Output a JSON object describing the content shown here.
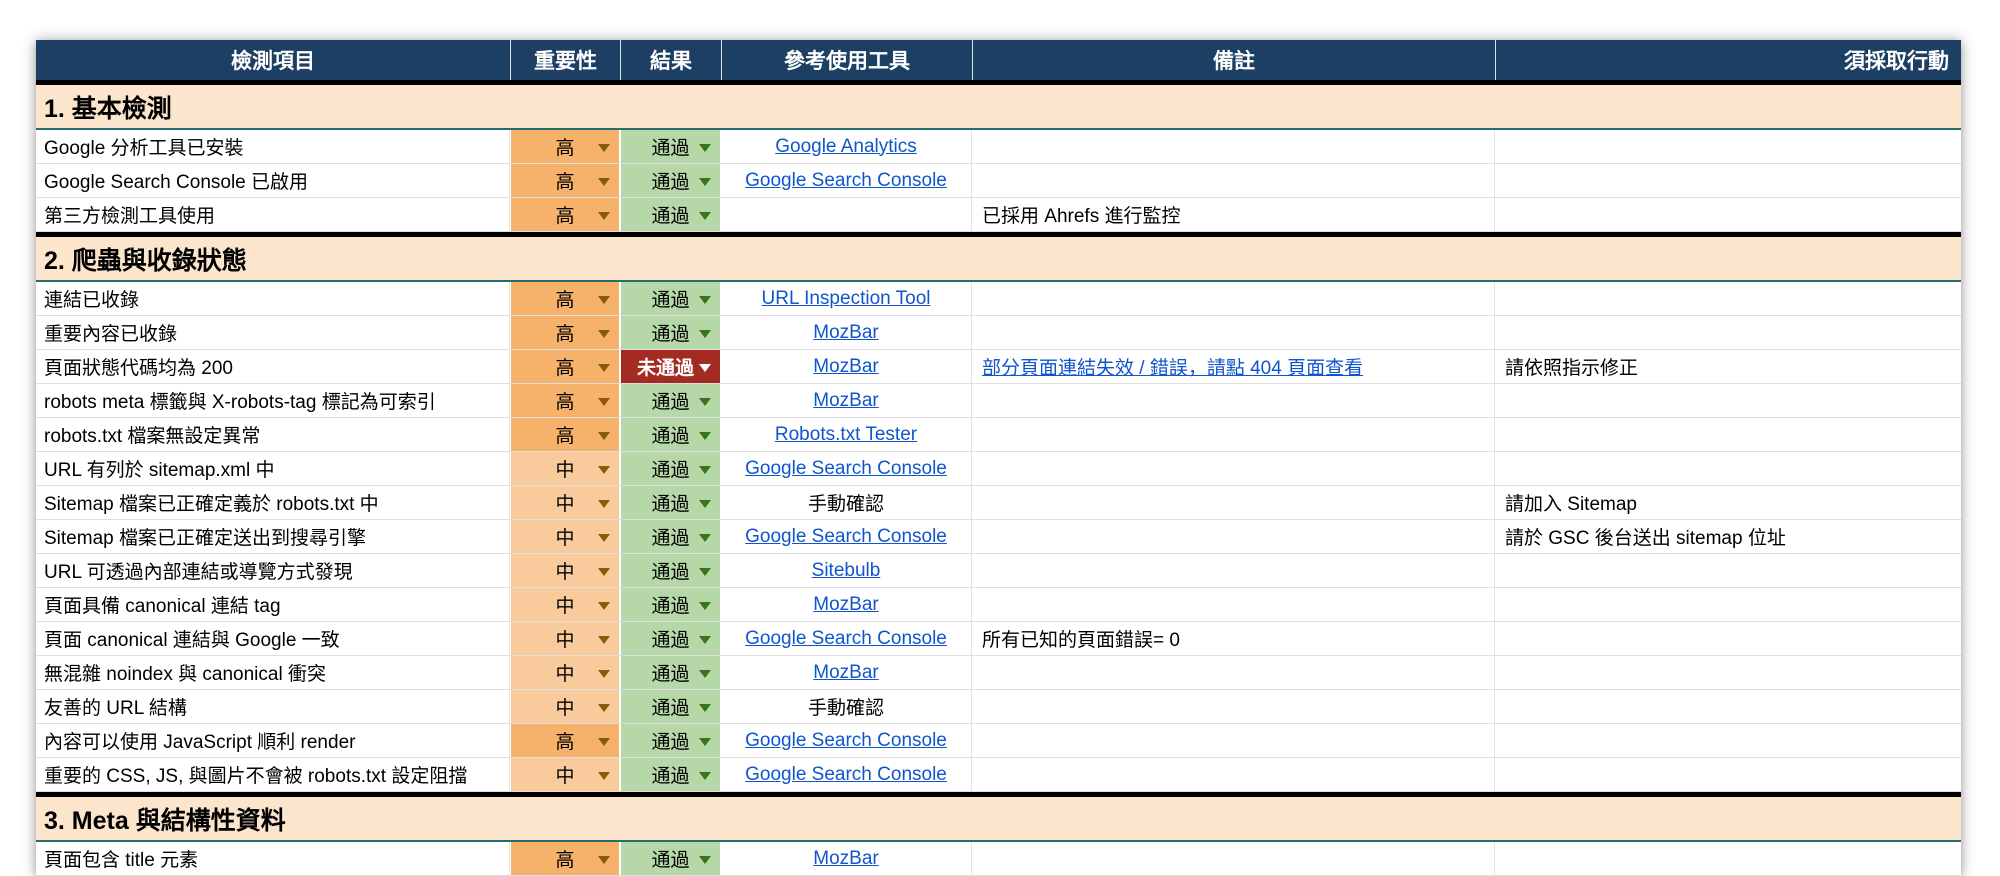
{
  "colors": {
    "header-bg": "#1c3f63",
    "section-bg": "#fce5cd",
    "teal-line": "#2a6b6e",
    "imp-high": "#f6b26b",
    "imp-mid": "#f9cb9c",
    "imp-arrow": "#8a5a0b",
    "pass-bg": "#b6d7a8",
    "pass-arrow": "#38761d",
    "fail-bg": "#a32b22",
    "link": "#1155cc",
    "divider": "#000000"
  },
  "table": {
    "columns": [
      {
        "label": "檢測項目"
      },
      {
        "label": "重要性"
      },
      {
        "label": "結果"
      },
      {
        "label": "參考使用工具"
      },
      {
        "label": "備註"
      },
      {
        "label": "須採取行動"
      }
    ],
    "sections": [
      {
        "title": "1. 基本檢測",
        "rows": [
          {
            "item": "Google 分析工具已安裝",
            "importance": "高",
            "importance_level": "high",
            "result": "通過",
            "result_state": "pass",
            "tool": "Google Analytics",
            "tool_link": true,
            "note": "",
            "note_link": false,
            "action": ""
          },
          {
            "item": "Google Search Console 已啟用",
            "importance": "高",
            "importance_level": "high",
            "result": "通過",
            "result_state": "pass",
            "tool": "Google Search Console",
            "tool_link": true,
            "note": "",
            "note_link": false,
            "action": ""
          },
          {
            "item": "第三方檢測工具使用",
            "importance": "高",
            "importance_level": "high",
            "result": "通過",
            "result_state": "pass",
            "tool": "",
            "tool_link": false,
            "note": "已採用 Ahrefs 進行監控",
            "note_link": false,
            "action": ""
          }
        ]
      },
      {
        "title": "2. 爬蟲與收錄狀態",
        "rows": [
          {
            "item": "連結已收錄",
            "importance": "高",
            "importance_level": "high",
            "result": "通過",
            "result_state": "pass",
            "tool": "URL Inspection Tool",
            "tool_link": true,
            "note": "",
            "note_link": false,
            "action": ""
          },
          {
            "item": "重要內容已收錄",
            "importance": "高",
            "importance_level": "high",
            "result": "通過",
            "result_state": "pass",
            "tool": "MozBar",
            "tool_link": true,
            "note": "",
            "note_link": false,
            "action": ""
          },
          {
            "item": "頁面狀態代碼均為 200",
            "importance": "高",
            "importance_level": "high",
            "result": "未通過",
            "result_state": "fail",
            "tool": "MozBar",
            "tool_link": true,
            "note": "部分頁面連結失效 / 錯誤，請點 404 頁面查看",
            "note_link": true,
            "action": "請依照指示修正"
          },
          {
            "item": "robots meta 標籤與 X-robots-tag 標記為可索引",
            "importance": "高",
            "importance_level": "high",
            "result": "通過",
            "result_state": "pass",
            "tool": "MozBar",
            "tool_link": true,
            "note": "",
            "note_link": false,
            "action": ""
          },
          {
            "item": "robots.txt 檔案無設定異常",
            "importance": "高",
            "importance_level": "high",
            "result": "通過",
            "result_state": "pass",
            "tool": "Robots.txt Tester",
            "tool_link": true,
            "note": "",
            "note_link": false,
            "action": ""
          },
          {
            "item": "URL 有列於 sitemap.xml 中",
            "importance": "中",
            "importance_level": "mid",
            "result": "通過",
            "result_state": "pass",
            "tool": "Google Search Console",
            "tool_link": true,
            "note": "",
            "note_link": false,
            "action": ""
          },
          {
            "item": "Sitemap 檔案已正確定義於 robots.txt 中",
            "importance": "中",
            "importance_level": "mid",
            "result": "通過",
            "result_state": "pass",
            "tool": "手動確認",
            "tool_link": false,
            "note": "",
            "note_link": false,
            "action": "請加入 Sitemap"
          },
          {
            "item": "Sitemap 檔案已正確定送出到搜尋引擎",
            "importance": "中",
            "importance_level": "mid",
            "result": "通過",
            "result_state": "pass",
            "tool": "Google Search Console",
            "tool_link": true,
            "note": "",
            "note_link": false,
            "action": "請於 GSC 後台送出 sitemap 位址"
          },
          {
            "item": "URL 可透過內部連結或導覽方式發現",
            "importance": "中",
            "importance_level": "mid",
            "result": "通過",
            "result_state": "pass",
            "tool": "Sitebulb",
            "tool_link": true,
            "note": "",
            "note_link": false,
            "action": ""
          },
          {
            "item": "頁面具備 canonical 連結 tag",
            "importance": "中",
            "importance_level": "mid",
            "result": "通過",
            "result_state": "pass",
            "tool": "MozBar",
            "tool_link": true,
            "note": "",
            "note_link": false,
            "action": ""
          },
          {
            "item": "頁面 canonical 連結與 Google 一致",
            "importance": "中",
            "importance_level": "mid",
            "result": "通過",
            "result_state": "pass",
            "tool": "Google Search Console",
            "tool_link": true,
            "note": "所有已知的頁面錯誤= 0",
            "note_link": false,
            "action": ""
          },
          {
            "item": "無混雜 noindex 與 canonical 衝突",
            "importance": "中",
            "importance_level": "mid",
            "result": "通過",
            "result_state": "pass",
            "tool": "MozBar",
            "tool_link": true,
            "note": "",
            "note_link": false,
            "action": ""
          },
          {
            "item": "友善的 URL 結構",
            "importance": "中",
            "importance_level": "mid",
            "result": "通過",
            "result_state": "pass",
            "tool": "手動確認",
            "tool_link": false,
            "note": "",
            "note_link": false,
            "action": ""
          },
          {
            "item": "內容可以使用 JavaScript 順利 render",
            "importance": "高",
            "importance_level": "high",
            "result": "通過",
            "result_state": "pass",
            "tool": "Google Search Console",
            "tool_link": true,
            "note": "",
            "note_link": false,
            "action": ""
          },
          {
            "item": "重要的 CSS, JS, 與圖片不會被 robots.txt 設定阻擋",
            "importance": "中",
            "importance_level": "mid",
            "result": "通過",
            "result_state": "pass",
            "tool": "Google Search Console",
            "tool_link": true,
            "note": "",
            "note_link": false,
            "action": ""
          }
        ]
      },
      {
        "title": "3. Meta 與結構性資料",
        "rows": [
          {
            "item": "頁面包含 title 元素",
            "importance": "高",
            "importance_level": "high",
            "result": "通過",
            "result_state": "pass",
            "tool": "MozBar",
            "tool_link": true,
            "note": "",
            "note_link": false,
            "action": ""
          }
        ]
      }
    ]
  }
}
